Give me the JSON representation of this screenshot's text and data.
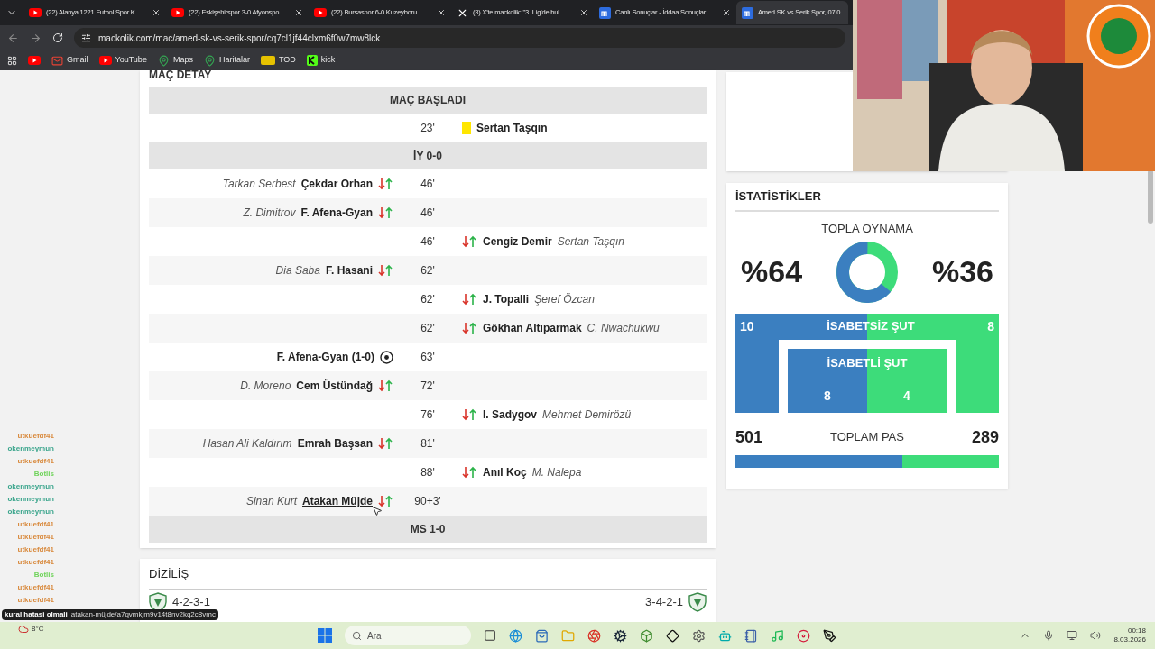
{
  "browser": {
    "tabs": [
      {
        "title": "(22) Alanya 1221 Futbol Spor K",
        "kind": "youtube",
        "selected": false
      },
      {
        "title": "(22) Eskişehirspor 3-0 Afyonspo",
        "kind": "youtube",
        "selected": false
      },
      {
        "title": "(22) Bursaspor 6-0 Kuzeyboru",
        "kind": "youtube",
        "selected": false
      },
      {
        "title": "(3) X'te mackolik: \"3. Lig'de bul",
        "kind": "x",
        "selected": false
      },
      {
        "title": "Canlı Sonuçlar - İddaa Sonuçlar",
        "kind": "site",
        "selected": false
      },
      {
        "title": "Amed SK vs Serik Spor, 07.0",
        "kind": "site",
        "selected": true
      }
    ],
    "address": "mackolik.com/mac/amed-sk-vs-serik-spor/cq7cl1jf44clxm6f0w7mw8lck",
    "bookmarks": [
      {
        "kind": "youtube"
      },
      {
        "kind": "gmail",
        "label": "Gmail"
      },
      {
        "kind": "youtube",
        "label": "YouTube"
      },
      {
        "kind": "maps",
        "label": "Maps"
      },
      {
        "kind": "maps",
        "label": "Haritalar"
      },
      {
        "kind": "tod",
        "label": "TOD"
      },
      {
        "kind": "kick",
        "label": "kick"
      }
    ]
  },
  "match_details": {
    "title": "MAÇ DETAY",
    "events": [
      {
        "kind": "header",
        "text": "MAÇ BAŞLADI"
      },
      {
        "kind": "away_booking",
        "minute": "23'",
        "player": "Sertan Taşqın",
        "hovered": false
      },
      {
        "kind": "header",
        "text": "İY 0-0"
      },
      {
        "kind": "home_substitution",
        "minute": "46'",
        "player": "Çekdar Orhan",
        "other": "Tarkan Serbest",
        "hovered": false
      },
      {
        "kind": "home_substitution",
        "minute": "46'",
        "player": "F. Afena-Gyan",
        "other": "Z. Dimitrov",
        "hovered": false
      },
      {
        "kind": "away_substitution",
        "minute": "46'",
        "player": "Cengiz Demir",
        "other": "Sertan Taşqın",
        "hovered": false
      },
      {
        "kind": "home_substitution",
        "minute": "62'",
        "player": "F. Hasani",
        "other": "Dia Saba",
        "hovered": false
      },
      {
        "kind": "away_substitution",
        "minute": "62'",
        "player": "J. Topalli",
        "other": "Şeref Özcan",
        "hovered": false
      },
      {
        "kind": "away_substitution",
        "minute": "62'",
        "player": "Gökhan Altıparmak",
        "other": "C. Nwachukwu",
        "hovered": false
      },
      {
        "kind": "home_goal",
        "minute": "63'",
        "player": "F. Afena-Gyan (1-0)",
        "hovered": false
      },
      {
        "kind": "home_substitution",
        "minute": "72'",
        "player": "Cem Üstündağ",
        "other": "D. Moreno",
        "hovered": false
      },
      {
        "kind": "away_substitution",
        "minute": "76'",
        "player": "I. Sadygov",
        "other": "Mehmet Demirözü",
        "hovered": false
      },
      {
        "kind": "home_substitution",
        "minute": "81'",
        "player": "Emrah Başsan",
        "other": "Hasan Ali Kaldırım",
        "hovered": false
      },
      {
        "kind": "away_substitution",
        "minute": "88'",
        "player": "Anıl Koç",
        "other": "M. Nalepa",
        "hovered": false
      },
      {
        "kind": "home_substitution",
        "minute": "90+3'",
        "player": "Atakan Müjde",
        "other": "Sinan Kurt",
        "hovered": true
      },
      {
        "kind": "header",
        "text": "MS 1-0"
      }
    ]
  },
  "lineup": {
    "title": "DİZİLİŞ",
    "home_formation": "4-2-3-1",
    "away_formation": "3-4-2-1"
  },
  "statistics": {
    "title": "İSTATİSTİKLER",
    "possession": {
      "label": "TOPLA OYNAMA",
      "home": "%64",
      "away": "%36",
      "level": 0.64
    },
    "shots_off": {
      "label": "İSABETSİZ ŞUT",
      "home": "10",
      "away": "8"
    },
    "shots_on": {
      "label": "İSABETLİ ŞUT",
      "home": "8",
      "away": "4"
    },
    "passes": {
      "label": "TOPLAM PAS",
      "home": "501",
      "away": "289",
      "level": 0.634
    }
  },
  "chat": {
    "messages": [
      {
        "user": "utkuefdf41",
        "color": "#d98b3f"
      },
      {
        "user": "okenmeymun",
        "color": "#3aa58c"
      },
      {
        "user": "utkuefdf41",
        "color": "#d98b3f"
      },
      {
        "user": "Botlis",
        "color": "#6fd35a"
      },
      {
        "user": "okenmeymun",
        "color": "#3aa58c"
      },
      {
        "user": "okenmeymun",
        "color": "#3aa58c"
      },
      {
        "user": "okenmeymun",
        "color": "#3aa58c"
      },
      {
        "user": "utkuefdf41",
        "color": "#d98b3f"
      },
      {
        "user": "utkuefdf41",
        "color": "#d98b3f"
      },
      {
        "user": "utkuefdf41",
        "color": "#d98b3f"
      },
      {
        "user": "utkuefdf41",
        "color": "#d98b3f"
      },
      {
        "user": "Botlis",
        "color": "#6fd35a"
      },
      {
        "user": "utkuefdf41",
        "color": "#d98b3f"
      },
      {
        "user": "utkuefdf41",
        "color": "#d98b3f"
      }
    ],
    "highlight": {
      "text": "kural hatasi olmali"
    }
  },
  "status_url": "atakan-müjde/a7qvmkjm9v14t8nv2kq2c8vmc",
  "weather": {
    "temp": "8°C"
  },
  "taskbar": {
    "search_placeholder": "Ara",
    "time": "00:18",
    "date": "8.03.2026"
  }
}
